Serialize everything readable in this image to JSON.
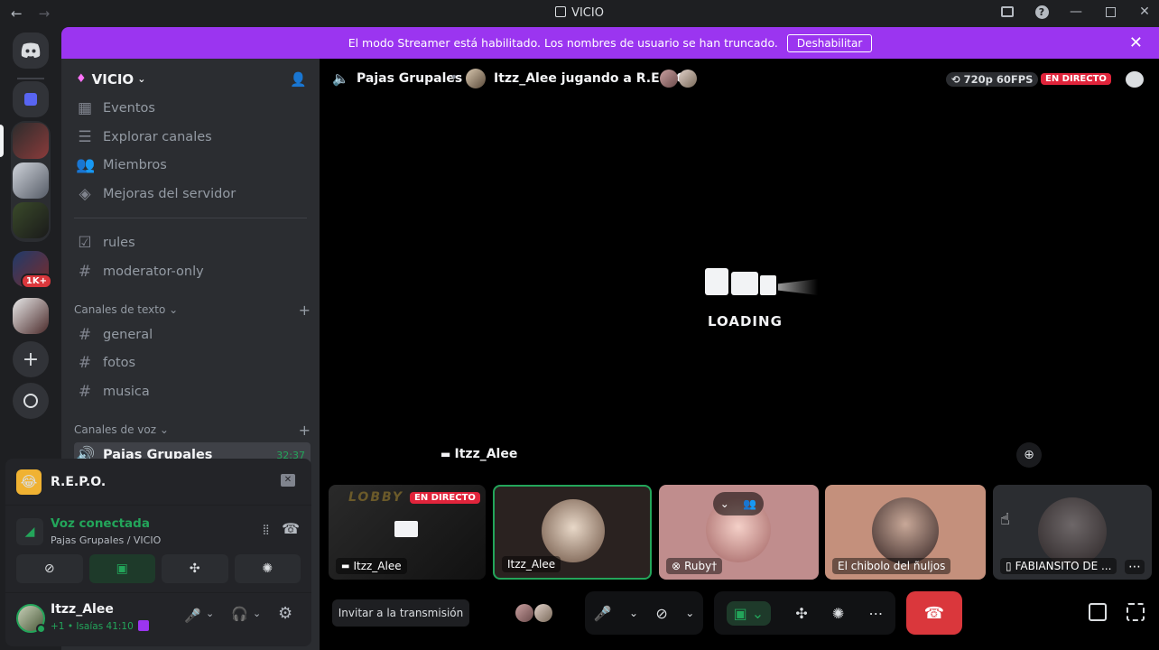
{
  "window": {
    "title": "VICIO"
  },
  "banner": {
    "message": "El modo Streamer está habilitado. Los nombres de usuario se han truncado.",
    "button": "Deshabilitar"
  },
  "server": {
    "name": "VICIO",
    "menu_items": [
      "Eventos",
      "Explorar canales",
      "Miembros",
      "Mejoras del servidor"
    ],
    "channels_top": [
      "rules",
      "moderator-only"
    ],
    "text_category": "Canales de texto",
    "text_channels": [
      "general",
      "fotos",
      "musica"
    ],
    "voice_category": "Canales de voz",
    "voice_channel": {
      "name": "Pajas Grupales",
      "time": "32:37"
    }
  },
  "rail": {
    "badge": "1K+"
  },
  "activity": {
    "name": "R.E.P.O."
  },
  "voice": {
    "status": "Voz conectada",
    "location": "Pajas Grupales / VICIO"
  },
  "user": {
    "name": "Itzz_Alee",
    "status": "+1 • Isaías 41:10"
  },
  "header": {
    "channel": "Pajas Grupales",
    "stream_title": "Itzz_Alee jugando a R.E.P.O.",
    "quality": "720p 60FPS",
    "live": "EN DIRECTO"
  },
  "stream": {
    "loading": "LOADING",
    "streamer": "Itzz_Alee"
  },
  "tiles": [
    {
      "label": "Itzz_Alee",
      "live": "EN DIRECTO",
      "game_text": "LOBBY"
    },
    {
      "label": "Itzz_Alee"
    },
    {
      "label": "Ruby†"
    },
    {
      "label": "El chibolo del ñuljos"
    },
    {
      "label": "FABIANSITO DE ..."
    }
  ],
  "controls": {
    "invite": "Invitar a la transmisión"
  },
  "colors": {
    "banner": "#9b35f0",
    "live": "#e0243b",
    "green": "#23a55a",
    "hangup": "#da373c"
  }
}
